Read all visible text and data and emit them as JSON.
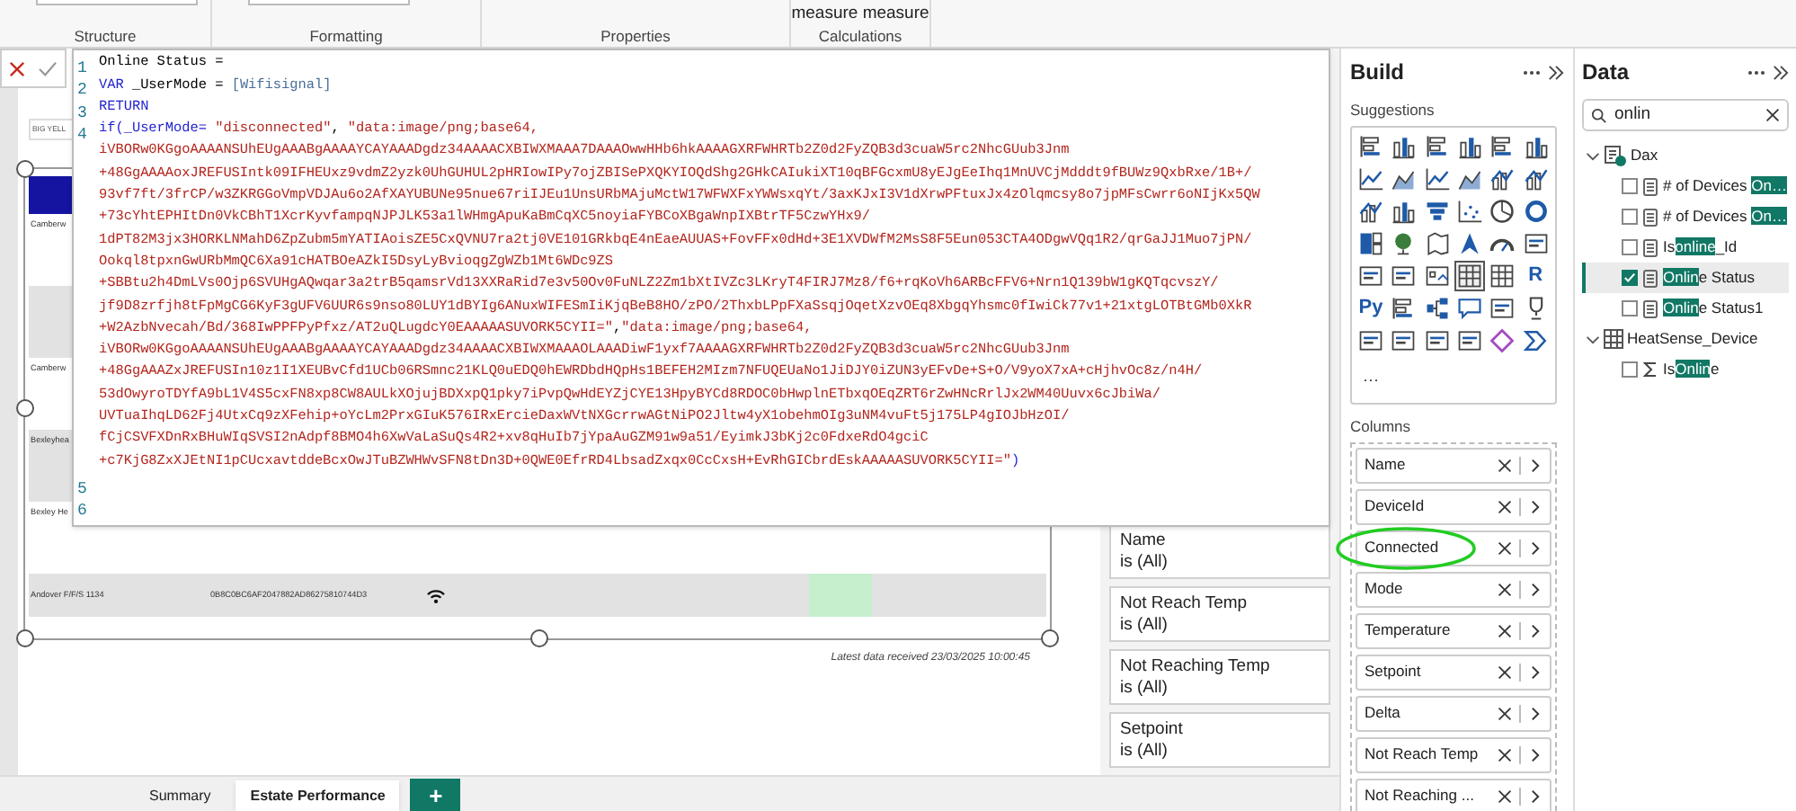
{
  "ribbon": {
    "groups": [
      {
        "label": "Structure",
        "field": true
      },
      {
        "label": "Formatting",
        "field": true
      },
      {
        "label": "Properties",
        "field": false
      },
      {
        "label": "Calculations",
        "field": false,
        "button": "measure measure"
      }
    ]
  },
  "report": {
    "card_title": "BIG YELL",
    "rows": [
      {
        "label": "Camberw",
        "shaded": false
      },
      {
        "shaded": true
      },
      {
        "label": "Camberw",
        "shaded": false
      },
      {
        "label": "Bexleyhea",
        "shaded": true
      },
      {
        "label": "Bexley He",
        "shaded": false
      },
      {
        "label": "Andover F/F/S 1134",
        "device_id": "0B8C0BC6AF2047882AD86275810744D3",
        "wifi": true,
        "highlight": true,
        "shaded": true
      }
    ],
    "footer": "Latest data received 23/03/2025 10:00:45"
  },
  "editor": {
    "lines": [
      {
        "number": "1",
        "rows": [
          {
            "segments": [
              {
                "kind": "p",
                "text": "Online Status ="
              }
            ]
          }
        ]
      },
      {
        "number": "2",
        "rows": [
          {
            "segments": [
              {
                "kind": "k",
                "text": "VAR"
              },
              {
                "kind": "p",
                "text": " _UserMode = "
              },
              {
                "kind": "r",
                "text": "[Wifisignal]"
              }
            ]
          }
        ]
      },
      {
        "number": "3",
        "rows": [
          {
            "segments": [
              {
                "kind": "k",
                "text": "RETURN"
              }
            ]
          }
        ]
      },
      {
        "number": "4",
        "rows": [
          {
            "segments": [
              {
                "kind": "k",
                "text": "if(_UserMode="
              },
              {
                "kind": "s",
                "text": " \"disconnected\""
              },
              {
                "kind": "p",
                "text": ", "
              },
              {
                "kind": "s",
                "text": "\"data:image/png;base64,"
              }
            ]
          },
          {
            "segments": [
              {
                "kind": "s",
                "text": "iVBORw0KGgoAAAANSUhEUgAAABgAAAAYCAYAAADgdz34AAAACXBIWXMAAA7DAAAOwwHHb6hkAAAAGXRFWHRTb2Z0d2FyZQB3d3cuaW5rc2NhcGUub3Jnm"
              }
            ]
          },
          {
            "segments": [
              {
                "kind": "s",
                "text": "+48GgAAAAoxJREFUSIntk09IFHEUxz9vdmZ2yzk0UhGUHUL2pHRIowIPy7ojZBISePXQKYIOQdShg2GHkCAIukiXT10qBFGcxmU8yEJgEeIhq1MnUVCjMdddt9fBUWz9QxbRxe/1B+/"
              }
            ]
          },
          {
            "segments": [
              {
                "kind": "s",
                "text": "93vf7ft/3frCP/w3ZKRGGoVmpVDJAu6o2AfXAYUBUNe95nue67riIJEu1UnsURbMAjuMctW17WFWXFxYWWsxqYt/3axKJxI3V1dXrwPFtuxJx4zOlqmcsy8o7jpMFsCwrr6oNIjKx5QW"
              }
            ]
          },
          {
            "segments": [
              {
                "kind": "s",
                "text": "+73cYhtEPHItDn0VkCBhT1XcrKyvfampqNJPJLK53a1lWHmgApuKaBmCqXC5noyiaFYBCoXBgaWnpIXBtrTF5CzwYHx9/"
              }
            ]
          },
          {
            "segments": [
              {
                "kind": "s",
                "text": "1dPT82M3jx3HORKLNMahD6ZpZubm5mYATIAoisZE5CxQVNU7ra2tj0VE101GRkbqE4nEaeAUUAS+FovFFx0dHd+3E1XVDWfM2MsS8F5Eun053CTA4ODgwVQq1R2/qrGaJJ1Muo7jPN/"
              }
            ]
          },
          {
            "segments": [
              {
                "kind": "s",
                "text": "Ookql8tpxnGwURbMmQC6Xa91cHATBOeAZkI5DsyLyBvioqgZgWZb1Mt6WDc9ZS"
              }
            ]
          },
          {
            "segments": [
              {
                "kind": "s",
                "text": "+SBBtu2h4DmLVs0Ojp6SVUHgAQwqar3a2trB5qamsrVd13XXRaRid7e3v50Ov0FuNLZ2Zm1bXtIVZc3LKryT4FIRJ7Mz8/f6+rqKoVh6ARBcFFV6+Nrn1Q139bW1gKQTqcvszY/"
              }
            ]
          },
          {
            "segments": [
              {
                "kind": "s",
                "text": "jf9D8zrfjh8tFpMgCG6KyF3gUFV6UUR6s9nso80LUY1dBYIg6ANuxWIFESmIiKjqBeB8HO/zPO/2ThxbLPpFXaSsqjOqetXzvOEq8XbgqYhsmc0fIwiCk77v1+21xtgLOTBtGMb0XkR"
              }
            ]
          },
          {
            "segments": [
              {
                "kind": "s",
                "text": "+W2AzbNvecah/Bd/368IwPPFPyPfxz/AT2uQLugdcY0EAAAAASUVORK5CYII=\""
              },
              {
                "kind": "p",
                "text": ","
              },
              {
                "kind": "s",
                "text": "\"data:image/png;base64,"
              }
            ]
          },
          {
            "segments": [
              {
                "kind": "s",
                "text": "iVBORw0KGgoAAAANSUhEUgAAABgAAAAYCAYAAADgdz34AAAACXBIWXMAAAOLAAADiwF1yxf7AAAAGXRFWHRTb2Z0d2FyZQB3d3cuaW5rc2NhcGUub3Jnm"
              }
            ]
          },
          {
            "segments": [
              {
                "kind": "s",
                "text": "+48GgAAAZxJREFUSIn10z1I1XEUBvCfd1UCb06RSmnc21KLQ0uEDQ0hEWRDbdHQpHs1BEFEH2MIzm7NFUQEUaNo1JiDJY0iZUN3yEFvDe+S+O/V9yoX7xA+cHjhvOc8z/n4H/"
              }
            ]
          },
          {
            "segments": [
              {
                "kind": "s",
                "text": "53dOwyroTDYfA9bL1V4S5cxFN8xp8CW8AULkXOjujBDXxpQ1pky7iPvpQwHdEYZjCYE13HpyBYCd8RDOC0bHwplnETbxqOEqZRT6rZwHNcRrlJx2WM40Uuvx6cJbiWa/"
              }
            ]
          },
          {
            "segments": [
              {
                "kind": "s",
                "text": "UVTuaIhqLD62Fj4UtxCq9zXFehip+oYcLm2PrxGIuK576IRxErcieDaxWVtNXGcrrwAGtNiPO2Jltw4yX1obehmOIg3uNM4vuFt5j175LP4gIOJbHzOI/"
              }
            ]
          },
          {
            "segments": [
              {
                "kind": "s",
                "text": "fCjCSVFXDnRxBHuWIqSVSI2nAdpf8BMO4h6XwVaLaSuQs4R2+xv8qHuIb7jYpaAuGZM91w9a51/EyimkJ3bKj2c0FdxeRdO4gciC"
              }
            ]
          },
          {
            "segments": [
              {
                "kind": "s",
                "text": "+c7KjG8ZxXJEtNI1pCUcxavtddeBcxOwJTuBZWHWvSFN8tDn3D+0QWE0EfrRD4LbsadZxqx0CcCxsH+EvRhGICbrdEskAAAAASUVORK5CYII=\""
              },
              {
                "kind": "k",
                "text": ")"
              }
            ]
          }
        ]
      },
      {
        "number": "5",
        "rows": [
          {}
        ]
      },
      {
        "number": "6",
        "rows": [
          {}
        ]
      }
    ]
  },
  "filters": [
    {
      "field": "Name",
      "condition": "is (All)"
    },
    {
      "field": "Not Reach Temp",
      "condition": "is (All)"
    },
    {
      "field": "Not Reaching Temp",
      "condition": "is (All)"
    },
    {
      "field": "Setpoint",
      "condition": "is (All)"
    }
  ],
  "page_tabs": [
    {
      "label": "Summary",
      "selected": false
    },
    {
      "label": "Estate Performance",
      "selected": true
    }
  ],
  "add_page_button": "+",
  "build": {
    "title": "Build",
    "suggestions_label": "Suggestions",
    "more": "···",
    "columns_label": "Columns",
    "visuals": [
      {
        "kind": "bar",
        "selected": false
      },
      {
        "kind": "column",
        "selected": false
      },
      {
        "kind": "bar",
        "selected": false
      },
      {
        "kind": "column",
        "selected": false
      },
      {
        "kind": "bar",
        "selected": false
      },
      {
        "kind": "column",
        "selected": false
      },
      {
        "kind": "line",
        "selected": false
      },
      {
        "kind": "area",
        "selected": false
      },
      {
        "kind": "line",
        "selected": false
      },
      {
        "kind": "area",
        "selected": false
      },
      {
        "kind": "combo",
        "selected": false
      },
      {
        "kind": "combo",
        "selected": false
      },
      {
        "kind": "combo",
        "selected": false
      },
      {
        "kind": "column",
        "selected": false
      },
      {
        "kind": "funnel",
        "selected": false
      },
      {
        "kind": "scatter",
        "selected": false
      },
      {
        "kind": "pie",
        "selected": false
      },
      {
        "kind": "donut",
        "selected": false
      },
      {
        "kind": "treemap",
        "selected": false
      },
      {
        "kind": "globe",
        "selected": false
      },
      {
        "kind": "map",
        "selected": false
      },
      {
        "kind": "arrow",
        "selected": false
      },
      {
        "kind": "gauge",
        "selected": false
      },
      {
        "kind": "card",
        "selected": false
      },
      {
        "kind": "card",
        "selected": false
      },
      {
        "kind": "card",
        "selected": false
      },
      {
        "kind": "slicer",
        "selected": false
      },
      {
        "kind": "table",
        "selected": true
      },
      {
        "kind": "table",
        "selected": false
      },
      {
        "kind": "glyph",
        "glyph": "R",
        "selected": false
      },
      {
        "kind": "glyph",
        "glyph": "Py",
        "selected": false
      },
      {
        "kind": "bar",
        "selected": false
      },
      {
        "kind": "tree",
        "selected": false
      },
      {
        "kind": "bubble",
        "selected": false
      },
      {
        "kind": "card",
        "selected": false
      },
      {
        "kind": "trophy",
        "selected": false
      },
      {
        "kind": "card",
        "selected": false
      },
      {
        "kind": "card",
        "selected": false
      },
      {
        "kind": "card",
        "selected": false
      },
      {
        "kind": "card",
        "selected": false
      },
      {
        "kind": "diamond",
        "selected": false
      },
      {
        "kind": "chevron",
        "selected": false
      }
    ],
    "columns": [
      {
        "label": "Name",
        "circled": false
      },
      {
        "label": "DeviceId",
        "circled": false
      },
      {
        "label": "Connected",
        "circled": true
      },
      {
        "label": "Mode",
        "circled": false
      },
      {
        "label": "Temperature",
        "circled": false
      },
      {
        "label": "Setpoint",
        "circled": false
      },
      {
        "label": "Delta",
        "circled": false
      },
      {
        "label": "Not Reach Temp",
        "circled": false
      },
      {
        "label": "Not Reaching ...",
        "circled": false
      }
    ]
  },
  "data": {
    "title": "Data",
    "search": {
      "value": "onlin"
    },
    "tables": [
      {
        "name": "Dax",
        "kind": "measure-table",
        "expanded": true,
        "children": [
          {
            "kind": "measure",
            "before": "# of Devices ",
            "match": "On…",
            "checked": false,
            "selected": false
          },
          {
            "kind": "measure",
            "before": "# of Devices ",
            "match": "On…",
            "checked": false,
            "selected": false
          },
          {
            "kind": "measure",
            "before": "Is",
            "match": "online",
            "after": "_Id",
            "checked": false,
            "selected": false
          },
          {
            "kind": "measure",
            "match": "Onlin",
            "after": "e Status",
            "checked": true,
            "selected": true
          },
          {
            "kind": "measure",
            "match": "Onlin",
            "after": "e Status1",
            "checked": false,
            "selected": false
          }
        ]
      },
      {
        "name": "HeatSense_Device",
        "kind": "table",
        "expanded": true,
        "children": [
          {
            "kind": "sum",
            "before": "Is",
            "match": "Onlin",
            "after": "e",
            "checked": false,
            "selected": false
          }
        ]
      }
    ]
  }
}
